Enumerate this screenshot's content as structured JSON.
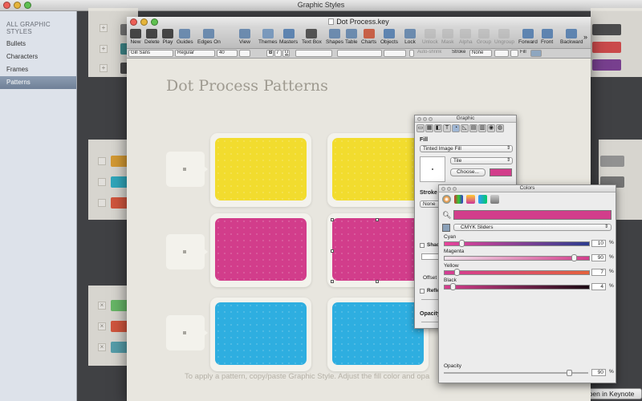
{
  "outer_window": {
    "title": "Graphic Styles"
  },
  "sidebar": {
    "header": "ALL GRAPHIC STYLES",
    "items": [
      {
        "label": "Bullets"
      },
      {
        "label": "Characters"
      },
      {
        "label": "Frames"
      },
      {
        "label": "Patterns",
        "selected": true
      }
    ]
  },
  "open_in_keynote": "pen in Keynote",
  "doc": {
    "title": "Dot Process.key",
    "toolbar": [
      {
        "label": "New",
        "icon": "new-icon"
      },
      {
        "label": "Delete",
        "icon": "delete-icon"
      },
      {
        "label": "Play",
        "icon": "play-icon"
      },
      {
        "label": "Guides",
        "icon": "guides-icon"
      },
      {
        "label": "Edges On",
        "icon": "edges-icon"
      },
      {
        "label": "View",
        "icon": "view-icon"
      },
      {
        "label": "Themes",
        "icon": "themes-icon"
      },
      {
        "label": "Masters",
        "icon": "masters-icon"
      },
      {
        "label": "Text Box",
        "icon": "text-box-icon"
      },
      {
        "label": "Shapes",
        "icon": "shapes-icon"
      },
      {
        "label": "Table",
        "icon": "table-icon"
      },
      {
        "label": "Charts",
        "icon": "charts-icon"
      },
      {
        "label": "Objects",
        "icon": "objects-icon"
      },
      {
        "label": "Lock",
        "icon": "lock-icon"
      },
      {
        "label": "Unlock",
        "icon": "unlock-icon",
        "disabled": true
      },
      {
        "label": "Mask",
        "icon": "mask-icon",
        "disabled": true
      },
      {
        "label": "Alpha",
        "icon": "alpha-icon",
        "disabled": true
      },
      {
        "label": "Group",
        "icon": "group-icon",
        "disabled": true
      },
      {
        "label": "Ungroup",
        "icon": "ungroup-icon",
        "disabled": true
      },
      {
        "label": "Forward",
        "icon": "forward-icon"
      },
      {
        "label": "Front",
        "icon": "front-icon"
      },
      {
        "label": "Backward",
        "icon": "backward-icon"
      }
    ],
    "format_bar": {
      "font": "Gill Sans",
      "style": "Regular",
      "size": "40",
      "bold": "B",
      "italic": "I",
      "underline": "U",
      "autoshrink": "Auto-shrink",
      "stroke_label": "Stroke",
      "stroke_value": "None",
      "fill_label": "Fill"
    },
    "slide": {
      "title": "Dot Process Patterns",
      "footer": "To apply a pattern, copy/paste Graphic Style. Adjust the fill color and opa",
      "rows": [
        {
          "color": "#f2dc2e"
        },
        {
          "color": "#d23d8b"
        },
        {
          "color": "#2eaee0"
        }
      ]
    }
  },
  "inspector": {
    "title": "Graphic",
    "fill_label": "Fill",
    "fill_type": "Tinted Image Fill",
    "tile_mode": "Tile",
    "choose_button": "Choose...",
    "tint_color": "#d23d8b",
    "stroke_label": "Stroke",
    "stroke_value": "None",
    "shadow_label": "Shad",
    "offset_label": "Offset",
    "reflection_label": "Refle",
    "opacity_label": "Opacity"
  },
  "colors_panel": {
    "title": "Colors",
    "current_color": "#d23d8b",
    "slider_type": "CMYK Sliders",
    "sliders": [
      {
        "label": "Cyan",
        "value": "10",
        "fraction": 0.1,
        "gradient": "linear-gradient(90deg,#e9439a,#2b3c8f)"
      },
      {
        "label": "Magenta",
        "value": "90",
        "fraction": 0.9,
        "gradient": "linear-gradient(90deg,#f2e3ec,#d23d8b)"
      },
      {
        "label": "Yellow",
        "value": "7",
        "fraction": 0.07,
        "gradient": "linear-gradient(90deg,#d43c95,#e5623c)"
      },
      {
        "label": "Black",
        "value": "4",
        "fraction": 0.04,
        "gradient": "linear-gradient(90deg,#d73e8e,#1a0a12)"
      }
    ],
    "percent": "%",
    "opacity_label": "Opacity",
    "opacity_value": "90",
    "opacity_fraction": 0.9
  }
}
